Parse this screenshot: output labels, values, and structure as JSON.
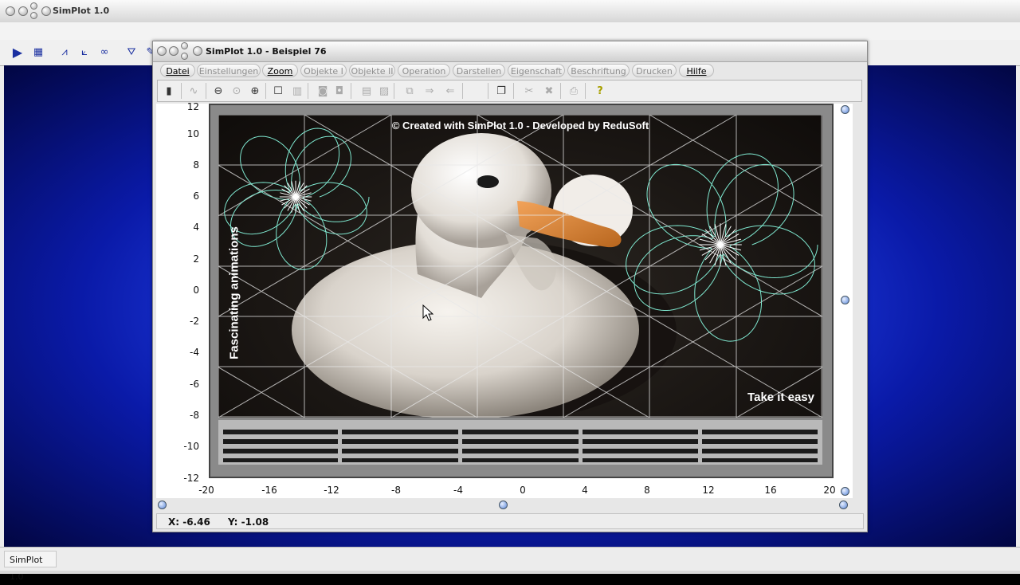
{
  "main_window": {
    "title": "SimPlot 1.0",
    "status": "SimPlot 1.0"
  },
  "child_window": {
    "title": "SimPlot 1.0 - Beispiel 76",
    "menu": [
      {
        "label": "Datei",
        "enabled": true
      },
      {
        "label": "Einstellungen",
        "enabled": false
      },
      {
        "label": "Zoom",
        "enabled": true
      },
      {
        "label": "Objekte I",
        "enabled": false
      },
      {
        "label": "Objekte II",
        "enabled": false
      },
      {
        "label": "Operation",
        "enabled": false
      },
      {
        "label": "Darstellen",
        "enabled": false
      },
      {
        "label": "Eigenschaft",
        "enabled": false
      },
      {
        "label": "Beschriftung",
        "enabled": false
      },
      {
        "label": "Drucken",
        "enabled": false
      },
      {
        "label": "Hilfe",
        "enabled": true
      }
    ]
  },
  "plot": {
    "y_ticks": [
      "12",
      "10",
      "8",
      "6",
      "4",
      "2",
      "0",
      "-2",
      "-4",
      "-6",
      "-8",
      "-10",
      "-12"
    ],
    "x_ticks": [
      "-20",
      "-16",
      "-12",
      "-8",
      "-4",
      "0",
      "4",
      "8",
      "12",
      "16",
      "20"
    ],
    "credit": "© Created with SimPlot 1.0 - Developed by ReduSoft",
    "side_caption": "Fascinating animations",
    "corner_caption": "Take it easy"
  },
  "status": {
    "x": "X: -6.46",
    "y": "Y: -1.08"
  },
  "colors": {
    "desktop": "#1a35d8",
    "spiro_cyan": "#7fe8d0",
    "spiro_white": "#ffffff"
  }
}
